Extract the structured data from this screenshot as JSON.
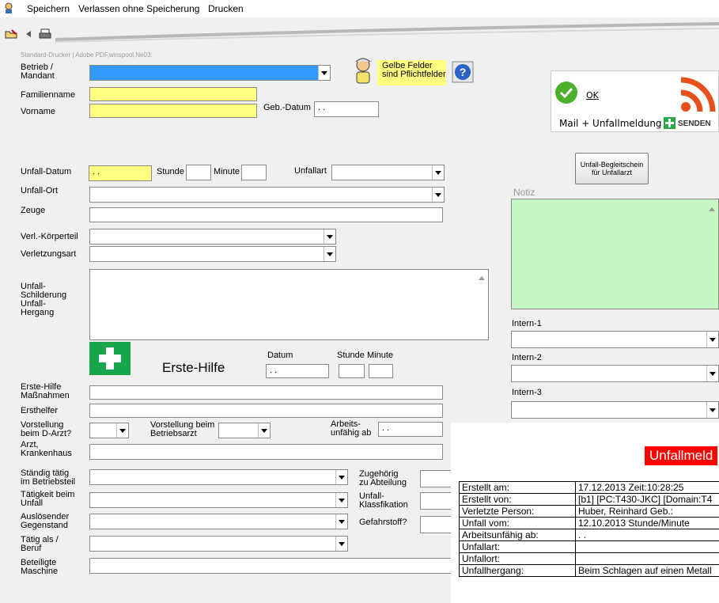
{
  "menu": {
    "save": "Speichern",
    "exit": "Verlassen ohne Speicherung",
    "print": "Drucken"
  },
  "printer_info": "Standard-Drucker |  Adobe PDF,winspool,Ne03:",
  "labels": {
    "betrieb": "Betrieb /\nMandant",
    "familienname": "Familienname",
    "vorname": "Vorname",
    "geb_datum": "Geb.-Datum",
    "required_note": "Gelbe Felder\nsind Pflichtfelder",
    "unfall_datum": "Unfall-Datum",
    "stunde": "Stunde",
    "minute": "Minute",
    "unfallart": "Unfallart",
    "unfall_ort": "Unfall-Ort",
    "zeuge": "Zeuge",
    "koerperteil": "Verl.-Körperteil",
    "verletzungsart": "Verletzungsart",
    "schilderung": "Unfall-\nSchilderung\nUnfall-\nHergang",
    "erste_hilfe": "Erste-Hilfe",
    "datum": "Datum",
    "stunde2": "Stunde",
    "minute2": "Minute",
    "eh_massnahmen": "Erste-Hilfe\nMaßnahmen",
    "ersthelfer": "Ersthelfer",
    "d_arzt": "Vorstellung\nbeim D-Arzt?",
    "betriebsarzt": "Vorstellung beim\nBetriebsarzt",
    "arbeitsunfaehig": "Arbeits-\nunfähig ab",
    "arzt": "Arzt,\nKrankenhaus",
    "betriebsteil": "Ständig tätig\nim Betriebsteil",
    "abteilung": "Zugehörig\nzu Abteilung",
    "taetigkeit": "Tätigkeit beim\nUnfall",
    "klassifikation": "Unfall-\nKlassfikation",
    "gegenstand": "Auslösender\nGegenstand",
    "gefahrstoff": "Gefahrstoff?",
    "beruf": "Tätig als /\nBeruf",
    "maschine": "Beteiligte\nMaschine",
    "notiz": "Notiz",
    "intern1": "Intern-1",
    "intern2": "Intern-2",
    "intern3": "Intern-3"
  },
  "values": {
    "geb_datum": " .  .",
    "unfall_datum": " .  .",
    "eh_datum": " .  .",
    "arbeitsunfaehig": " .  ."
  },
  "begleitschein_button": "Unfall-Begleitschein\nfür Unfallarzt",
  "send_panel": {
    "ok": "OK",
    "text": "Mail + Unfallmeldung",
    "send": "SENDEN"
  },
  "report": {
    "title": "Unfallmeld",
    "rows": [
      [
        "Erstellt am:",
        "17.12.2013 Zeit:10:28:25"
      ],
      [
        "Erstellt von:",
        "[b1] [PC:T430-JKC] [Domain:T4"
      ],
      [
        "Verletzte Person:",
        "Huber, Reinhard          Geb.:"
      ],
      [
        "Unfall vom:",
        "12.10.2013      Stunde/Minute"
      ],
      [
        "Arbeitsunfähig ab:",
        "  .  ."
      ],
      [
        "Unfallart:",
        ""
      ],
      [
        "Unfallort:",
        ""
      ],
      [
        "Unfallhergang:",
        "Beim Schlagen auf einen Metall"
      ]
    ]
  },
  "colors": {
    "required": "#ffff80",
    "notiz": "#c4f7c4",
    "highlight": "#3399ff",
    "report_title": "#ff0000"
  }
}
